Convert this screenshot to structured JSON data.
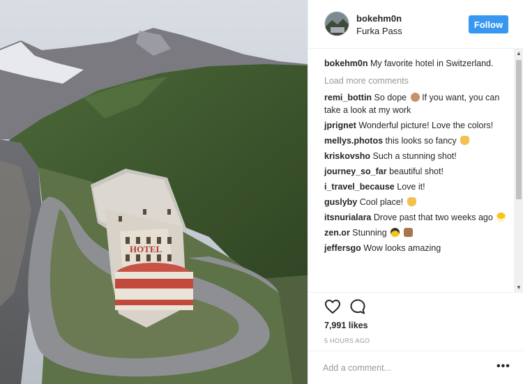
{
  "post": {
    "username": "bokehm0n",
    "location": "Furka Pass",
    "follow_label": "Follow",
    "caption_text": "My favorite hotel in Switzerland.",
    "hotel_sign": "HOTEL",
    "load_more_label": "Load more comments"
  },
  "comments": [
    {
      "user": "remi_bottin",
      "text": "So dope",
      "emoji": "fist-bump-emoji",
      "text2": "If you want, you can take a look at my work"
    },
    {
      "user": "jprignet",
      "text": "Wonderful picture! Love the colors!"
    },
    {
      "user": "mellys.photos",
      "text": "this looks so fancy",
      "emoji": "ok-hand-emoji"
    },
    {
      "user": "kriskovsho",
      "text": "Such a stunning shot!"
    },
    {
      "user": "journey_so_far",
      "text": "beautiful shot!"
    },
    {
      "user": "i_travel_because",
      "text": "Love it!"
    },
    {
      "user": "guslyby",
      "text": "Cool place!",
      "emoji": "ok-hand-emoji"
    },
    {
      "user": "itsnurialara",
      "text": "Drove past that two weeks ago",
      "emoji": "grinning-face-emoji"
    },
    {
      "user": "zen.or",
      "text": "Stunning",
      "emoji": "sunglasses-face-emoji",
      "emoji2": "clapping-hands-emoji"
    },
    {
      "user": "jeffersgo",
      "text": "Wow looks amazing"
    }
  ],
  "footer": {
    "likes": "7,991 likes",
    "timestamp": "5 HOURS AGO",
    "add_comment_placeholder": "Add a comment...",
    "more_label": "•••"
  },
  "icons": {
    "like": "heart-icon",
    "comment": "speech-bubble-icon",
    "more": "more-options-icon"
  },
  "colors": {
    "accent": "#3897f0",
    "muted": "#999999",
    "text": "#262626"
  }
}
